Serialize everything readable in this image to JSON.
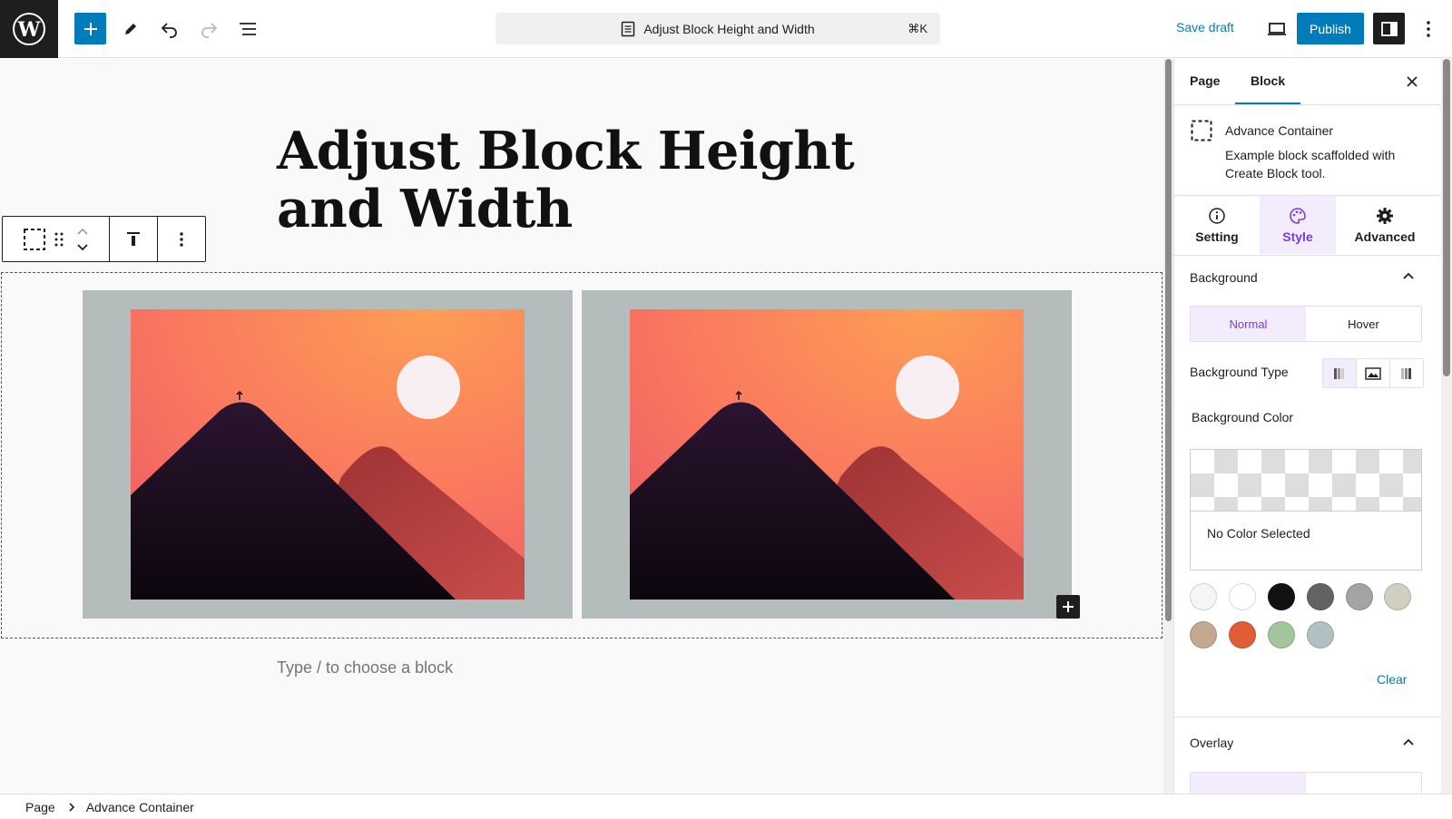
{
  "header": {
    "doc_title": "Adjust Block Height and Width",
    "shortcut": "⌘K",
    "save_draft": "Save draft",
    "publish": "Publish",
    "icons": [
      "wordpress-logo",
      "plus-icon",
      "pencil-icon",
      "undo-icon",
      "redo-icon",
      "list-view-icon",
      "document-icon",
      "preview-icon",
      "sidebar-toggle-icon",
      "more-vertical-icon"
    ]
  },
  "editor": {
    "page_title": "Adjust Block Height and Width",
    "placeholder": "Type / to choose a block"
  },
  "sidebar": {
    "tabs": [
      "Page",
      "Block"
    ],
    "block_name": "Advance Container",
    "block_desc": "Example block scaffolded with Create Block tool.",
    "style_tabs": [
      "Setting",
      "Style",
      "Advanced"
    ],
    "background": {
      "title": "Background",
      "states": [
        "Normal",
        "Hover"
      ],
      "type_label": "Background Type",
      "color_label": "Background Color",
      "no_color": "No Color Selected",
      "clear": "Clear"
    },
    "overlay_title": "Overlay",
    "swatches": [
      "#f6f6f6",
      "#ffffff",
      "#111111",
      "#636363",
      "#a4a4a4",
      "#d1cfc0",
      "#c2a990",
      "#e05d38",
      "#a2c59b",
      "#b1c0c0"
    ]
  },
  "breadcrumb": [
    "Page",
    "Advance Container"
  ],
  "colors": {
    "accent": "#007cba",
    "style_accent": "#7a3cd8",
    "column_bg": "#b5bdbc"
  }
}
